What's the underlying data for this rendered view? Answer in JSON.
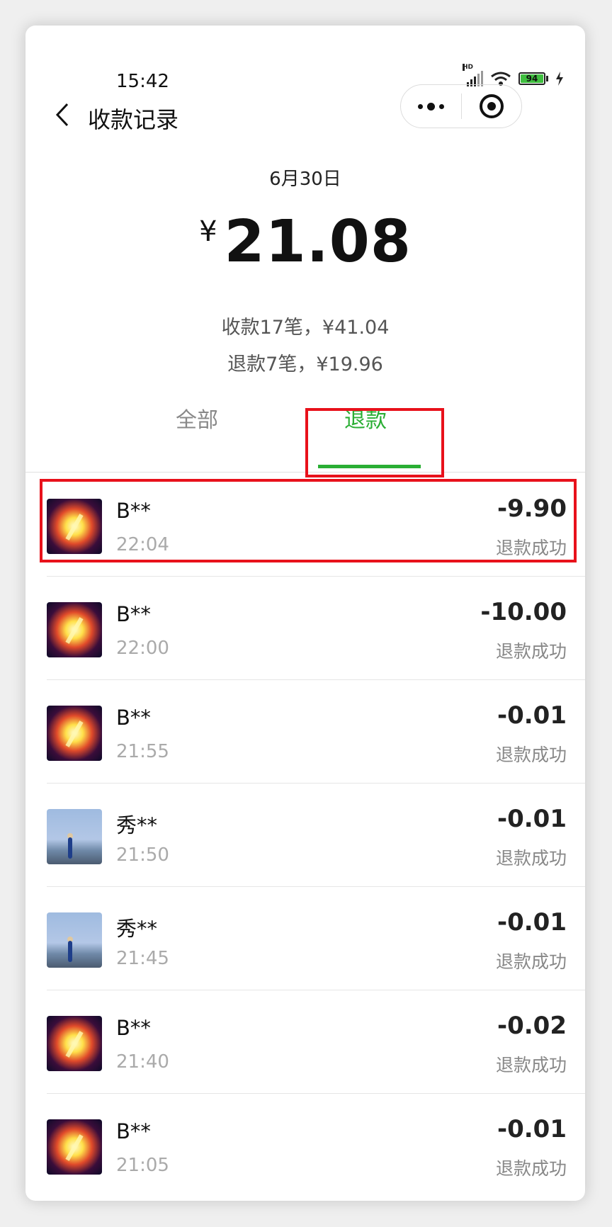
{
  "status_bar": {
    "time": "15:42",
    "network_label": "HD",
    "battery_level": "94"
  },
  "nav": {
    "title": "收款记录"
  },
  "summary": {
    "date": "6月30日",
    "currency": "¥",
    "total": "21.08",
    "received_line": "收款17笔，¥41.04",
    "refund_line": "退款7笔，¥19.96"
  },
  "tabs": [
    {
      "label": "全部",
      "active": false
    },
    {
      "label": "退款",
      "active": true
    }
  ],
  "colors": {
    "accent": "#2aae34",
    "highlight": "#e8111b"
  },
  "records": [
    {
      "name": "B**",
      "time": "22:04",
      "amount": "-9.90",
      "status": "退款成功",
      "avatar": "b"
    },
    {
      "name": "B**",
      "time": "22:00",
      "amount": "-10.00",
      "status": "退款成功",
      "avatar": "b"
    },
    {
      "name": "B**",
      "time": "21:55",
      "amount": "-0.01",
      "status": "退款成功",
      "avatar": "b"
    },
    {
      "name": "秀**",
      "time": "21:50",
      "amount": "-0.01",
      "status": "退款成功",
      "avatar": "x"
    },
    {
      "name": "秀**",
      "time": "21:45",
      "amount": "-0.01",
      "status": "退款成功",
      "avatar": "x"
    },
    {
      "name": "B**",
      "time": "21:40",
      "amount": "-0.02",
      "status": "退款成功",
      "avatar": "b"
    },
    {
      "name": "B**",
      "time": "21:05",
      "amount": "-0.01",
      "status": "退款成功",
      "avatar": "b"
    }
  ]
}
